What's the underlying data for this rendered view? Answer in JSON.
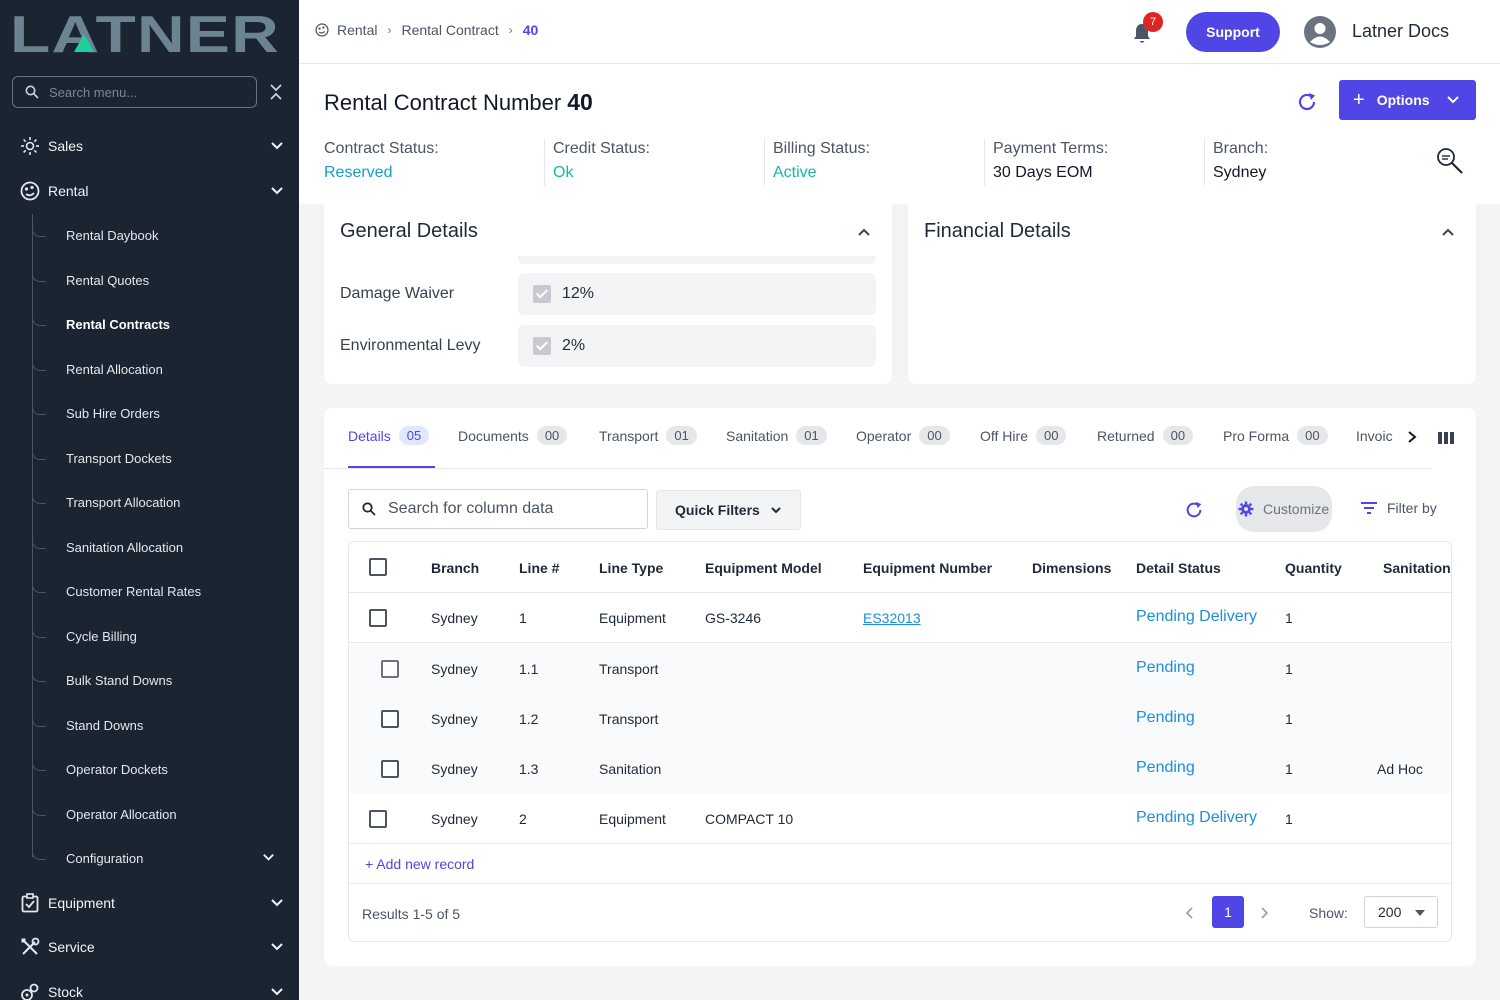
{
  "app": {
    "logo_text": "LATNER",
    "search_placeholder": "Search menu..."
  },
  "sidebar": {
    "top_items": [
      {
        "label": "Sales",
        "icon": "sales-icon"
      },
      {
        "label": "Rental",
        "icon": "rental-icon"
      },
      {
        "label": "Equipment",
        "icon": "equipment-icon"
      },
      {
        "label": "Service",
        "icon": "service-icon"
      },
      {
        "label": "Stock",
        "icon": "stock-icon"
      }
    ],
    "rental_sub_items": [
      {
        "label": "Rental Daybook"
      },
      {
        "label": "Rental Quotes"
      },
      {
        "label": "Rental Contracts",
        "active": true
      },
      {
        "label": "Rental Allocation"
      },
      {
        "label": "Sub Hire Orders"
      },
      {
        "label": "Transport Dockets"
      },
      {
        "label": "Transport Allocation"
      },
      {
        "label": "Sanitation Allocation"
      },
      {
        "label": "Customer Rental Rates"
      },
      {
        "label": "Cycle Billing"
      },
      {
        "label": "Bulk Stand Downs"
      },
      {
        "label": "Stand Downs"
      },
      {
        "label": "Operator Dockets"
      },
      {
        "label": "Operator Allocation"
      },
      {
        "label": "Configuration"
      }
    ]
  },
  "header": {
    "breadcrumb": [
      "Rental",
      "Rental Contract",
      "40"
    ],
    "notification_count": "7",
    "support_label": "Support",
    "user_name": "Latner Docs"
  },
  "contract": {
    "title": "Rental Contract Number",
    "number": "40",
    "options_label": "Options",
    "statuses": [
      {
        "label": "Contract Status:",
        "value": "Reserved",
        "color": "#14a0c8"
      },
      {
        "label": "Credit Status:",
        "value": "Ok",
        "color": "#14b8a6"
      },
      {
        "label": "Billing Status:",
        "value": "Active",
        "color": "#14b8a6"
      },
      {
        "label": "Payment Terms:",
        "value": "30 Days EOM"
      },
      {
        "label": "Branch:",
        "value": "Sydney"
      }
    ]
  },
  "general_details": {
    "title": "General Details",
    "fields": [
      {
        "label": "Damage Waiver",
        "value": "12%",
        "checked": true
      },
      {
        "label": "Environmental Levy",
        "value": "2%",
        "checked": true
      }
    ]
  },
  "financial_details": {
    "title": "Financial Details"
  },
  "tabs": [
    {
      "label": "Details",
      "count": "05",
      "active": true
    },
    {
      "label": "Documents",
      "count": "00"
    },
    {
      "label": "Transport",
      "count": "01"
    },
    {
      "label": "Sanitation",
      "count": "01"
    },
    {
      "label": "Operator",
      "count": "00"
    },
    {
      "label": "Off Hire",
      "count": "00"
    },
    {
      "label": "Returned",
      "count": "00"
    },
    {
      "label": "Pro Forma",
      "count": "00"
    },
    {
      "label": "Invoic"
    }
  ],
  "toolbar": {
    "search_placeholder": "Search for column data",
    "quick_filters_label": "Quick Filters",
    "customize_label": "Customize",
    "filter_by_label": "Filter by"
  },
  "table": {
    "columns": [
      "Branch",
      "Line #",
      "Line Type",
      "Equipment Model",
      "Equipment Number",
      "Dimensions",
      "Detail Status",
      "Quantity",
      "Sanitation"
    ],
    "rows": [
      {
        "branch": "Sydney",
        "line": "1",
        "type": "Equipment",
        "model": "GS-3246",
        "number": "ES32013",
        "dimensions": "",
        "status": "Pending Delivery",
        "qty": "1",
        "sanitation": "",
        "child": false
      },
      {
        "branch": "Sydney",
        "line": "1.1",
        "type": "Transport",
        "model": "",
        "number": "",
        "dimensions": "",
        "status": "Pending",
        "qty": "1",
        "sanitation": "",
        "child": true
      },
      {
        "branch": "Sydney",
        "line": "1.2",
        "type": "Transport",
        "model": "",
        "number": "",
        "dimensions": "",
        "status": "Pending",
        "qty": "1",
        "sanitation": "",
        "child": true
      },
      {
        "branch": "Sydney",
        "line": "1.3",
        "type": "Sanitation",
        "model": "",
        "number": "",
        "dimensions": "",
        "status": "Pending",
        "qty": "1",
        "sanitation": "Ad Hoc",
        "child": true
      },
      {
        "branch": "Sydney",
        "line": "2",
        "type": "Equipment",
        "model": "COMPACT 10",
        "number": "",
        "dimensions": "",
        "status": "Pending Delivery",
        "qty": "1",
        "sanitation": "",
        "child": false
      }
    ],
    "add_record_label": "+ Add new record",
    "results_text": "Results 1-5 of 5",
    "current_page": "1",
    "show_label": "Show:",
    "page_size": "200"
  }
}
